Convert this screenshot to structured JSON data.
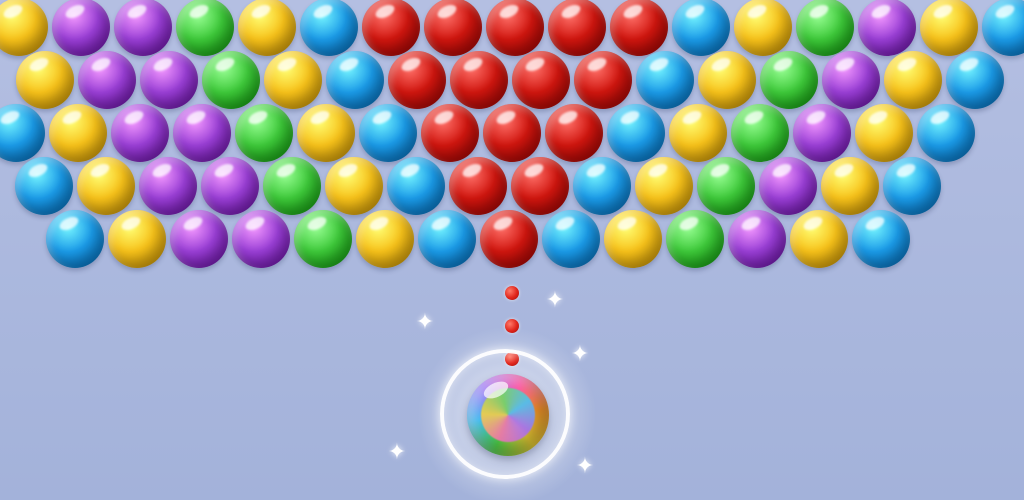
{
  "colors": {
    "yellow": "#f7c21a",
    "purple": "#9a3fd6",
    "green": "#3ec93a",
    "blue": "#1b9be8",
    "red": "#d0160f",
    "background_top": "#b4bfe2",
    "background_bottom": "#a3b2da"
  },
  "board": {
    "rows": [
      [
        "yellow",
        "purple",
        "purple",
        "green",
        "yellow",
        "blue",
        "red",
        "red",
        "red",
        "red",
        "red",
        "blue",
        "yellow",
        "green",
        "purple",
        "yellow",
        "blue"
      ],
      [
        "yellow",
        "purple",
        "purple",
        "green",
        "yellow",
        "blue",
        "red",
        "red",
        "red",
        "red",
        "blue",
        "yellow",
        "green",
        "purple",
        "yellow",
        "blue"
      ],
      [
        "blue",
        "yellow",
        "purple",
        "purple",
        "green",
        "yellow",
        "blue",
        "red",
        "red",
        "red",
        "blue",
        "yellow",
        "green",
        "purple",
        "yellow",
        "blue"
      ],
      [
        "blue",
        "yellow",
        "purple",
        "purple",
        "green",
        "yellow",
        "blue",
        "red",
        "red",
        "blue",
        "yellow",
        "green",
        "purple",
        "yellow",
        "blue"
      ],
      [
        "blue",
        "yellow",
        "purple",
        "purple",
        "green",
        "yellow",
        "blue",
        "red",
        "blue",
        "yellow",
        "green",
        "purple",
        "yellow",
        "blue"
      ]
    ]
  },
  "shooter": {
    "ball_type": "rainbow-bubble",
    "aim_dots": 3,
    "aim_dot_color": "red"
  },
  "decor": {
    "sparkle_glyph": "✦",
    "sparkle_count": 5
  }
}
